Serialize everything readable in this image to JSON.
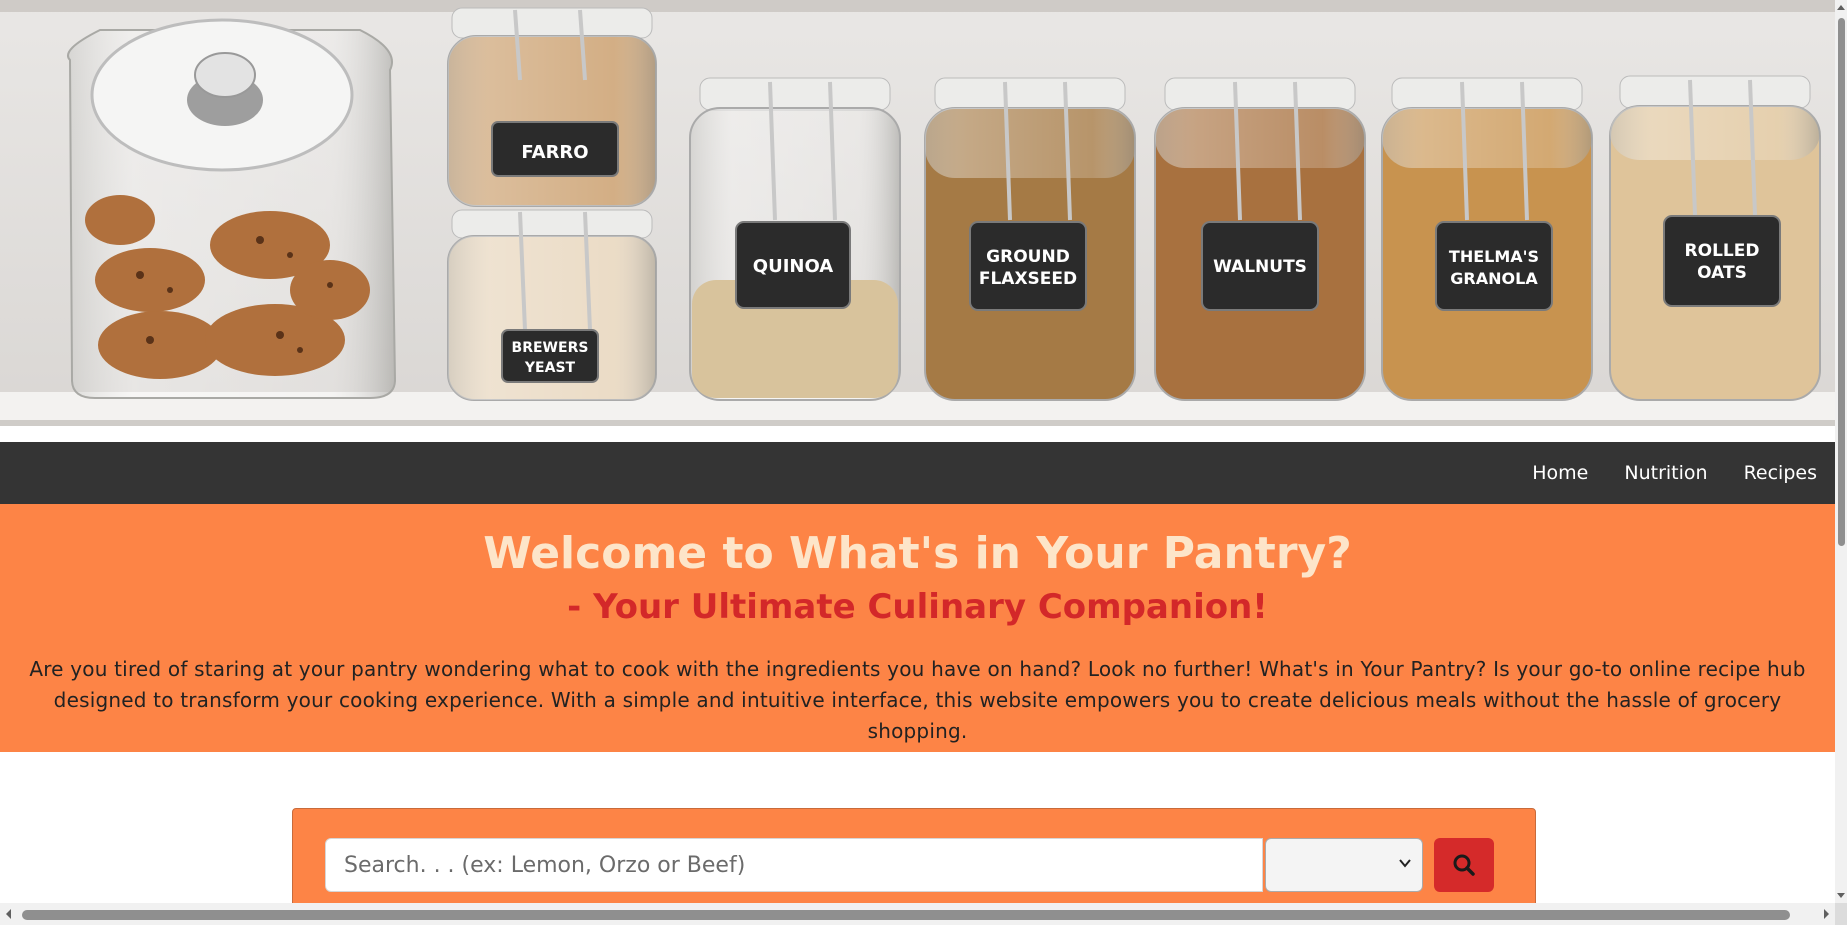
{
  "hero": {
    "image_alt": "Pantry shelf with labeled glass jars",
    "jar_labels": [
      {
        "line1": "FARRO",
        "line2": ""
      },
      {
        "line1": "BREWERS",
        "line2": "YEAST"
      },
      {
        "line1": "QUINOA",
        "line2": ""
      },
      {
        "line1": "GROUND",
        "line2": "FLAXSEED"
      },
      {
        "line1": "WALNUTS",
        "line2": ""
      },
      {
        "line1": "THELMA'S",
        "line2": "GRANOLA"
      },
      {
        "line1": "ROLLED",
        "line2": "OATS"
      }
    ]
  },
  "nav": {
    "items": [
      {
        "label": "Home"
      },
      {
        "label": "Nutrition"
      },
      {
        "label": "Recipes"
      }
    ]
  },
  "banner": {
    "title": "Welcome to What's in Your Pantry?",
    "subtitle": "- Your Ultimate Culinary Companion!",
    "description": "Are you tired of staring at your pantry wondering what to cook with the ingredients you have on hand? Look no further! What's in Your Pantry? Is your go-to online recipe hub designed to transform your cooking experience. With a simple and intuitive interface, this website empowers you to create delicious meals without the hassle of grocery shopping."
  },
  "search": {
    "placeholder": "Search. . . (ex: Lemon, Orzo or Beef)",
    "value": "",
    "filter_selected": "",
    "button_icon": "search-icon"
  },
  "colors": {
    "navbar_bg": "#343434",
    "banner_bg": "#fd8446",
    "title_color": "#fde5c9",
    "subtitle_color": "#d32829",
    "search_button_bg": "#d52a2a"
  }
}
